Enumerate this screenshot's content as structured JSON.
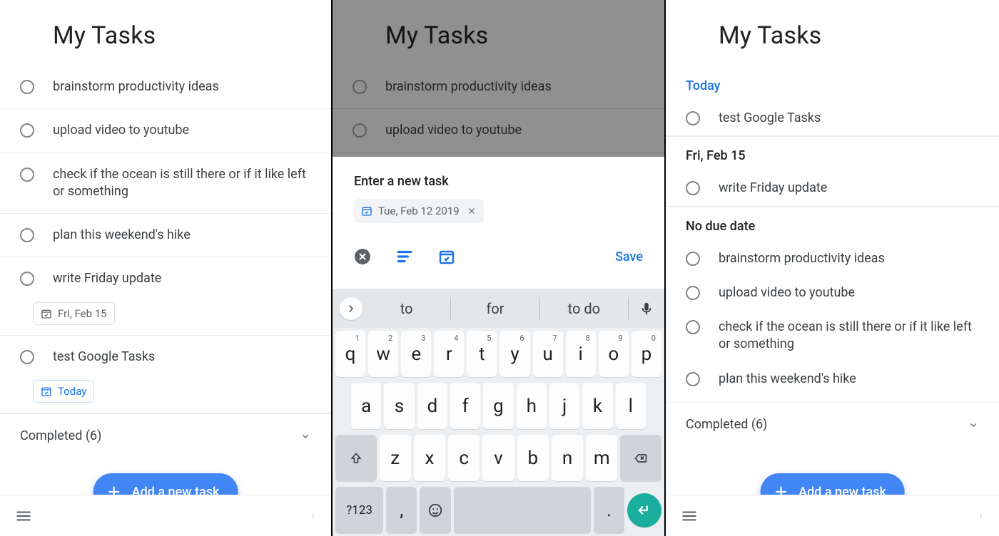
{
  "colors": {
    "accent": "#1a73e8",
    "fab": "#4285f4",
    "enter": "#1aae9f"
  },
  "screen1": {
    "title": "My Tasks",
    "tasks": [
      {
        "text": "brainstorm productivity ideas"
      },
      {
        "text": "upload video to youtube"
      },
      {
        "text": "check if the ocean is still there or if it like left or something"
      },
      {
        "text": "plan this weekend's hike"
      },
      {
        "text": "write Friday update",
        "date": "Fri, Feb 15"
      },
      {
        "text": "test Google Tasks",
        "date": "Today",
        "today": true
      }
    ],
    "completed_label": "Completed (6)",
    "fab_label": "Add a new task"
  },
  "screen2": {
    "title": "My Tasks",
    "bg_tasks": [
      {
        "text": "brainstorm productivity ideas"
      },
      {
        "text": "upload video to youtube"
      }
    ],
    "sheet": {
      "placeholder": "Enter a new task",
      "date_chip": "Tue, Feb 12 2019",
      "save_label": "Save"
    },
    "keyboard": {
      "suggestions": [
        "to",
        "for",
        "to do"
      ],
      "row1": [
        {
          "l": "q",
          "n": "1"
        },
        {
          "l": "w",
          "n": "2"
        },
        {
          "l": "e",
          "n": "3"
        },
        {
          "l": "r",
          "n": "4"
        },
        {
          "l": "t",
          "n": "5"
        },
        {
          "l": "y",
          "n": "6"
        },
        {
          "l": "u",
          "n": "7"
        },
        {
          "l": "i",
          "n": "8"
        },
        {
          "l": "o",
          "n": "9"
        },
        {
          "l": "p",
          "n": "0"
        }
      ],
      "row2": [
        "a",
        "s",
        "d",
        "f",
        "g",
        "h",
        "j",
        "k",
        "l"
      ],
      "row3": [
        "z",
        "x",
        "c",
        "v",
        "b",
        "n",
        "m"
      ],
      "row4_sym": "?123",
      "row4_comma": ",",
      "row4_period": "."
    }
  },
  "screen3": {
    "title": "My Tasks",
    "sections": [
      {
        "label": "Today",
        "type": "today",
        "tasks": [
          {
            "text": "test Google Tasks"
          }
        ]
      },
      {
        "label": "Fri, Feb 15",
        "type": "date",
        "tasks": [
          {
            "text": "write Friday update"
          }
        ]
      },
      {
        "label": "No due date",
        "type": "nodate",
        "tasks": [
          {
            "text": "brainstorm productivity ideas"
          },
          {
            "text": "upload video to youtube"
          },
          {
            "text": "check if the ocean is still there or if it like left or something"
          },
          {
            "text": "plan this weekend's hike"
          }
        ]
      }
    ],
    "completed_label": "Completed (6)",
    "fab_label": "Add a new task"
  }
}
